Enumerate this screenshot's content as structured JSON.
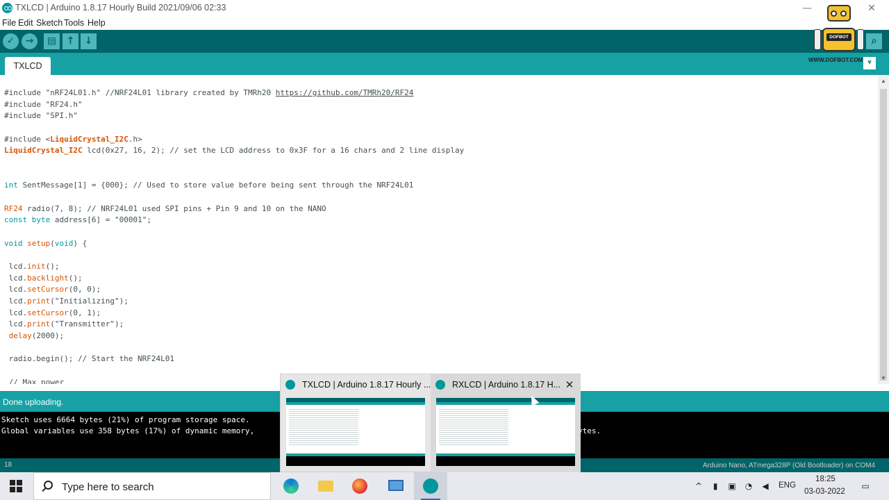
{
  "window": {
    "title": "TXLCD | Arduino 1.8.17 Hourly Build 2021/09/06 02:33",
    "minimize": "—",
    "close": "✕"
  },
  "menu": [
    "File",
    "Edit",
    "Sketch",
    "Tools",
    "Help"
  ],
  "toolbar": {
    "verify_icon": "check-icon",
    "upload_icon": "arrow-right-icon",
    "new_icon": "file-icon",
    "open_icon": "arrow-up-icon",
    "save_icon": "arrow-down-icon",
    "serial_icon": "magnifier-icon"
  },
  "tabs": [
    {
      "label": "TXLCD"
    }
  ],
  "overlay": {
    "brand_plate": "DOFBOT",
    "brand_url": "WWW.DOFBOT.COM"
  },
  "colors": {
    "toolbar_bg": "#006468",
    "tabbar_bg": "#17a1a5",
    "button_bg": "#4db7bb",
    "keyword": "#00979c",
    "type_keyword": "#d35400"
  },
  "code": {
    "l1_a": "#include \"nRF24L01.h\" //NRF24L01 library created by TMRh20 ",
    "l1_link": "https://github.com/TMRh20/RF24",
    "l2": "#include \"RF24.h\"",
    "l3": "#include \"SPI.h\"",
    "l4_a": "#include <",
    "l4_b": "LiquidCrystal_I2C",
    "l4_c": ".h>",
    "l5_a": "LiquidCrystal_I2C",
    "l5_b": " lcd(0x27, 16, 2); // set the LCD address to 0x3F for a 16 chars and 2 line display",
    "l6_a": "int",
    "l6_b": " SentMessage[1] = {000}; // Used to store value before being sent through the NRF24L01",
    "l7_a": "RF24",
    "l7_b": " radio(7, 8); // NRF24L01 used SPI pins + Pin 9 and 10 on the NANO",
    "l8_a": "const",
    "l8_b": " ",
    "l8_c": "byte",
    "l8_d": " address[6] = \"00001\";",
    "l9_a": "void",
    "l9_b": " ",
    "l9_c": "setup",
    "l9_d": "(",
    "l9_e": "void",
    "l9_f": ") {",
    "l10_a": " lcd.",
    "l10_b": "init",
    "l10_c": "();",
    "l11_a": " lcd.",
    "l11_b": "backlight",
    "l11_c": "();",
    "l12_a": " lcd.",
    "l12_b": "setCursor",
    "l12_c": "(0, 0);",
    "l13_a": " lcd.",
    "l13_b": "print",
    "l13_c": "(\"Initializing\");",
    "l14_a": " lcd.",
    "l14_b": "setCursor",
    "l14_c": "(0, 1);",
    "l15_a": " lcd.",
    "l15_b": "print",
    "l15_c": "(\"Transmitter\");",
    "l16_a": " ",
    "l16_b": "delay",
    "l16_c": "(2000);",
    "l17": " radio.begin(); // Start the NRF24L01",
    "l18": " // Max power"
  },
  "status": {
    "message": "Done uploading."
  },
  "console": {
    "line1": "Sketch uses 6664 bytes (21%) of program storage space.",
    "line2": "Global variables use 358 bytes (17%) of dynamic memory,",
    "line2_tail": "ytes."
  },
  "bottom_bar": {
    "line_number": "18",
    "board": "Arduino Nano, ATmega328P (Old Bootloader) on COM4"
  },
  "task_previews": [
    {
      "title": "TXLCD | Arduino 1.8.17 Hourly ..."
    },
    {
      "title": "RXLCD | Arduino 1.8.17 H..."
    }
  ],
  "taskbar": {
    "search_placeholder": "Type here to search",
    "language": "ENG",
    "time": "18:25",
    "date": "03-03-2022",
    "apps": [
      "edge-icon",
      "file-explorer-icon",
      "firefox-icon",
      "pc-icon",
      "arduino-icon"
    ]
  }
}
